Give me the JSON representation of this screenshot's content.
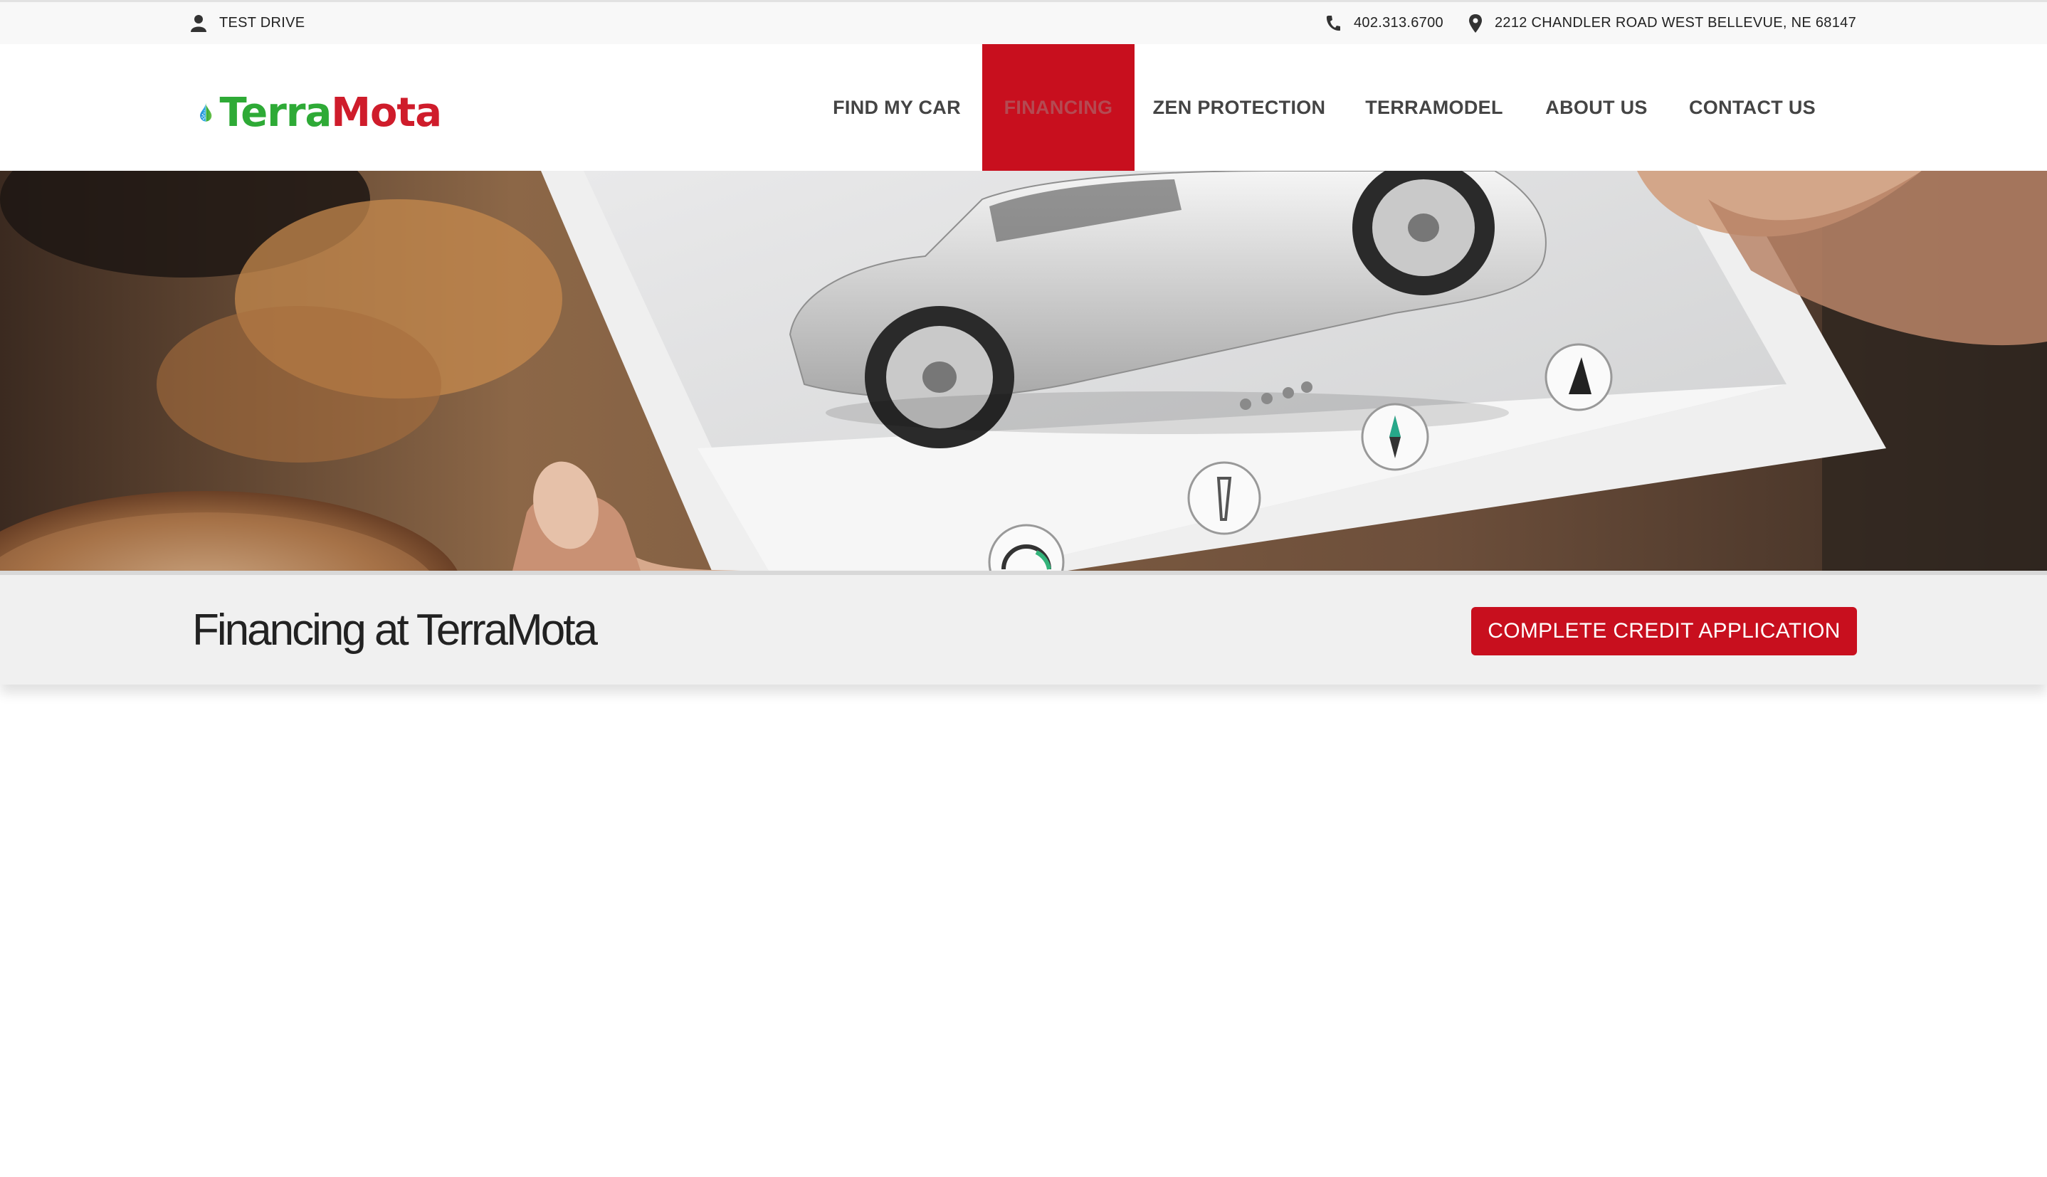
{
  "topbar": {
    "test_drive": "TEST DRIVE",
    "phone": "402.313.6700",
    "address": "2212 CHANDLER ROAD WEST BELLEVUE, NE 68147"
  },
  "logo": {
    "part1": "Terra",
    "part2": "Mota"
  },
  "nav": {
    "items": [
      {
        "label": "FIND MY CAR"
      },
      {
        "label": "FINANCING",
        "active": true
      },
      {
        "label": "ZEN PROTECTION"
      },
      {
        "label": "TERRAMODEL"
      },
      {
        "label": "ABOUT US"
      },
      {
        "label": "CONTACT US"
      }
    ]
  },
  "page": {
    "title": "Financing at TerraMota",
    "cta_label": "COMPLETE CREDIT APPLICATION"
  },
  "colors": {
    "accent": "#c80f1e",
    "logo_green": "#2eaa36",
    "logo_red": "#cf1c2b",
    "band_bg": "#f0f0f0"
  },
  "icons": [
    "user-icon",
    "phone-icon",
    "map-pin-icon",
    "wrench-icon",
    "compass-icon",
    "traffic-cone-icon",
    "gauge-icon"
  ]
}
